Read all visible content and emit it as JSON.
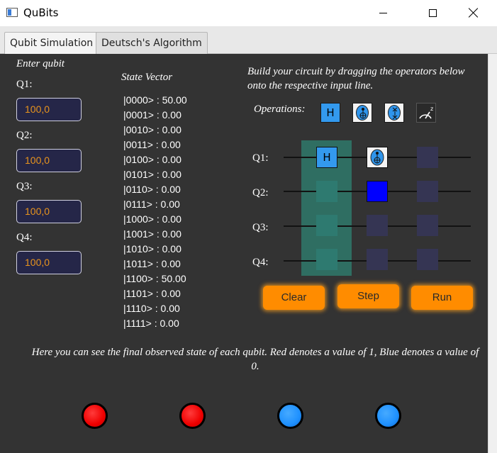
{
  "window": {
    "title": "QuBits"
  },
  "tabs": [
    {
      "label": "Qubit Simulation",
      "active": true
    },
    {
      "label": "Deutsch's Algorithm",
      "active": false
    }
  ],
  "inputs": {
    "heading": "Enter qubit",
    "qubits": [
      {
        "label": "Q1:",
        "value": "100,0"
      },
      {
        "label": "Q2:",
        "value": "100,0"
      },
      {
        "label": "Q3:",
        "value": "100,0"
      },
      {
        "label": "Q4:",
        "value": "100,0"
      }
    ]
  },
  "state_vector": {
    "heading": "State Vector",
    "rows": [
      "|0000> : 50.00",
      "|0001> : 0.00",
      "|0010> : 0.00",
      "|0011> : 0.00",
      "|0100> : 0.00",
      "|0101> : 0.00",
      "|0110> : 0.00",
      "|0111> : 0.00",
      "|1000> : 0.00",
      "|1001> : 0.00",
      "|1010> : 0.00",
      "|1011> : 0.00",
      "|1100> : 50.00",
      "|1101> : 0.00",
      "|1110> : 0.00",
      "|1111> : 0.00"
    ]
  },
  "circuit": {
    "instructions": "Build your circuit by dragging the operators below onto the respective input line.",
    "operations_label": "Operations:",
    "operations": [
      {
        "icon": "hadamard-gate-icon",
        "label": "H"
      },
      {
        "icon": "control-dot-icon"
      },
      {
        "icon": "swap-icon"
      },
      {
        "icon": "measurement-meter-icon"
      }
    ],
    "line_labels": [
      "Q1:",
      "Q2:",
      "Q3:",
      "Q4:"
    ],
    "placed_gates": {
      "q1_col1": "H"
    },
    "buttons": {
      "clear": "Clear",
      "step": "Step",
      "run": "Run"
    }
  },
  "results": {
    "text": "Here you can see the final observed state of each qubit. Red denotes a value of 1, Blue denotes a value of 0.",
    "qubits": [
      {
        "state": "red",
        "color": "#ee0000"
      },
      {
        "state": "red",
        "color": "#ee0000"
      },
      {
        "state": "blue",
        "color": "#1e90ff"
      },
      {
        "state": "blue",
        "color": "#1e90ff"
      }
    ]
  },
  "colors": {
    "accent_orange": "#ff8c00",
    "gate_blue": "#3399ee",
    "target_blue": "#0000ff",
    "panel_bg": "#333333",
    "input_bg": "#252648",
    "input_text": "#e8941d",
    "highlight_green": "#2f6e62"
  }
}
